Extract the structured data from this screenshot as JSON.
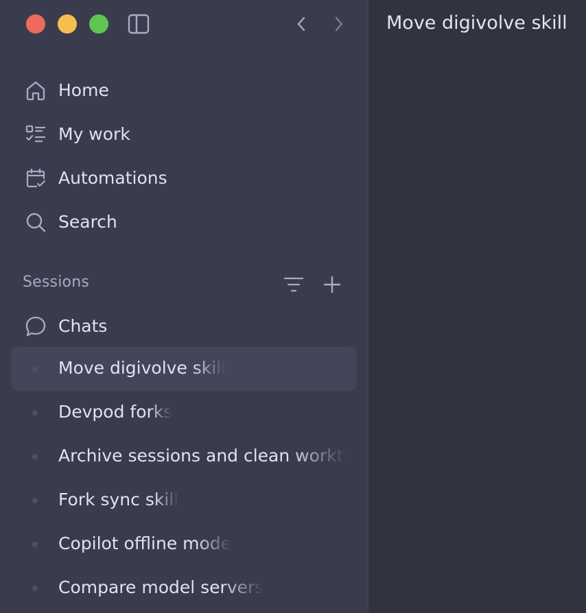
{
  "window": {
    "title": "Move digivolve skill"
  },
  "toolbar": {
    "close": "close-button",
    "minimize": "minimize-button",
    "maximize": "maximize-button",
    "sidebar_toggle_icon": "sidebar-toggle-icon",
    "back_icon": "chevron-left-icon",
    "forward_icon": "chevron-right-icon"
  },
  "nav": {
    "items": [
      {
        "label": "Home",
        "icon": "home-icon"
      },
      {
        "label": "My work",
        "icon": "checklist-icon"
      },
      {
        "label": "Automations",
        "icon": "calendar-check-icon"
      },
      {
        "label": "Search",
        "icon": "search-icon"
      }
    ]
  },
  "sessions": {
    "title": "Sessions",
    "filter_icon": "filter-icon",
    "add_icon": "plus-icon",
    "group": {
      "label": "Chats",
      "icon": "chat-bubble-icon"
    },
    "items": [
      {
        "label": "Move digivolve skill",
        "active": true
      },
      {
        "label": "Devpod forks",
        "active": false
      },
      {
        "label": "Archive sessions and clean worktrees",
        "active": false
      },
      {
        "label": "Fork sync skill",
        "active": false
      },
      {
        "label": "Copilot offline mode",
        "active": false
      },
      {
        "label": "Compare model servers",
        "active": false
      }
    ]
  },
  "colors": {
    "sidebar_bg": "#3a3c4e",
    "main_bg": "#31333f",
    "active_row": "#434658",
    "traffic_close": "#ee6a5f",
    "traffic_min": "#f5bf4f",
    "traffic_max": "#61c554"
  }
}
